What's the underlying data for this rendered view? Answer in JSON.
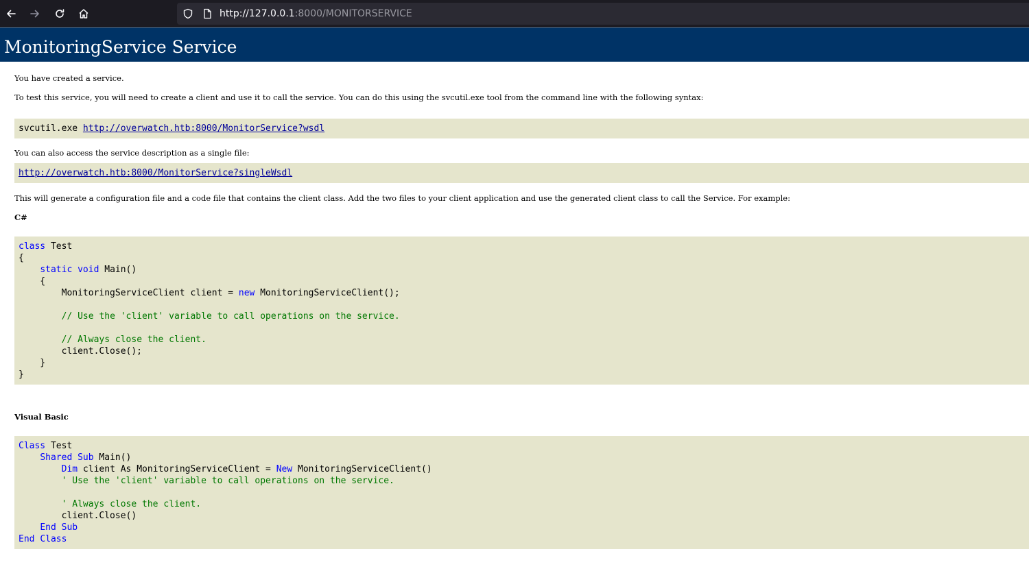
{
  "browser": {
    "url_main": "http://127.0.0.1",
    "url_rest": ":8000/MONITORSERVICE"
  },
  "page": {
    "title": "MonitoringService Service",
    "created_text": "You have created a service.",
    "test_text": "To test this service, you will need to create a client and use it to call the service. You can do this using the svcutil.exe tool from the command line with the following syntax:",
    "svcutil_cmd": "svcutil.exe ",
    "wsdl_link": "http://overwatch.htb:8000/MonitorService?wsdl",
    "single_file_text": "You can also access the service description as a single file:",
    "single_wsdl_link": "http://overwatch.htb:8000/MonitorService?singleWsdl",
    "generate_text": "This will generate a configuration file and a code file that contains the client class. Add the two files to your client application and use the generated client class to call the Service. For example:",
    "csharp_heading": "C#",
    "vb_heading": "Visual Basic"
  },
  "csharp_code": [
    [
      {
        "t": "class",
        "c": "kw"
      },
      {
        "t": " Test",
        "c": ""
      }
    ],
    [
      {
        "t": "{",
        "c": ""
      }
    ],
    [
      {
        "t": "    ",
        "c": ""
      },
      {
        "t": "static",
        "c": "kw"
      },
      {
        "t": " ",
        "c": ""
      },
      {
        "t": "void",
        "c": "kw"
      },
      {
        "t": " Main()",
        "c": ""
      }
    ],
    [
      {
        "t": "    {",
        "c": ""
      }
    ],
    [
      {
        "t": "        MonitoringServiceClient client = ",
        "c": ""
      },
      {
        "t": "new",
        "c": "kw"
      },
      {
        "t": " MonitoringServiceClient();",
        "c": ""
      }
    ],
    [
      {
        "t": "",
        "c": ""
      }
    ],
    [
      {
        "t": "        ",
        "c": ""
      },
      {
        "t": "// Use the 'client' variable to call operations on the service.",
        "c": "cm"
      }
    ],
    [
      {
        "t": "",
        "c": ""
      }
    ],
    [
      {
        "t": "        ",
        "c": ""
      },
      {
        "t": "// Always close the client.",
        "c": "cm"
      }
    ],
    [
      {
        "t": "        client.Close();",
        "c": ""
      }
    ],
    [
      {
        "t": "    }",
        "c": ""
      }
    ],
    [
      {
        "t": "}",
        "c": ""
      }
    ]
  ],
  "vb_code": [
    [
      {
        "t": "Class",
        "c": "kw"
      },
      {
        "t": " Test",
        "c": ""
      }
    ],
    [
      {
        "t": "    ",
        "c": ""
      },
      {
        "t": "Shared",
        "c": "kw"
      },
      {
        "t": " ",
        "c": ""
      },
      {
        "t": "Sub",
        "c": "kw"
      },
      {
        "t": " Main()",
        "c": ""
      }
    ],
    [
      {
        "t": "        ",
        "c": ""
      },
      {
        "t": "Dim",
        "c": "kw"
      },
      {
        "t": " client As MonitoringServiceClient = ",
        "c": ""
      },
      {
        "t": "New",
        "c": "kw"
      },
      {
        "t": " MonitoringServiceClient()",
        "c": ""
      }
    ],
    [
      {
        "t": "        ",
        "c": ""
      },
      {
        "t": "' Use the 'client' variable to call operations on the service.",
        "c": "cm"
      }
    ],
    [
      {
        "t": "",
        "c": ""
      }
    ],
    [
      {
        "t": "        ",
        "c": ""
      },
      {
        "t": "' Always close the client.",
        "c": "cm"
      }
    ],
    [
      {
        "t": "        client.Close()",
        "c": ""
      }
    ],
    [
      {
        "t": "    ",
        "c": ""
      },
      {
        "t": "End",
        "c": "kw"
      },
      {
        "t": " ",
        "c": ""
      },
      {
        "t": "Sub",
        "c": "kw"
      }
    ],
    [
      {
        "t": "End",
        "c": "kw"
      },
      {
        "t": " ",
        "c": ""
      },
      {
        "t": "Class",
        "c": "kw"
      }
    ]
  ],
  "colors": {
    "header_bg": "#003366",
    "code_bg": "#e5e5cc",
    "keyword": "#0000ff",
    "comment": "#007700",
    "link": "#000099"
  }
}
